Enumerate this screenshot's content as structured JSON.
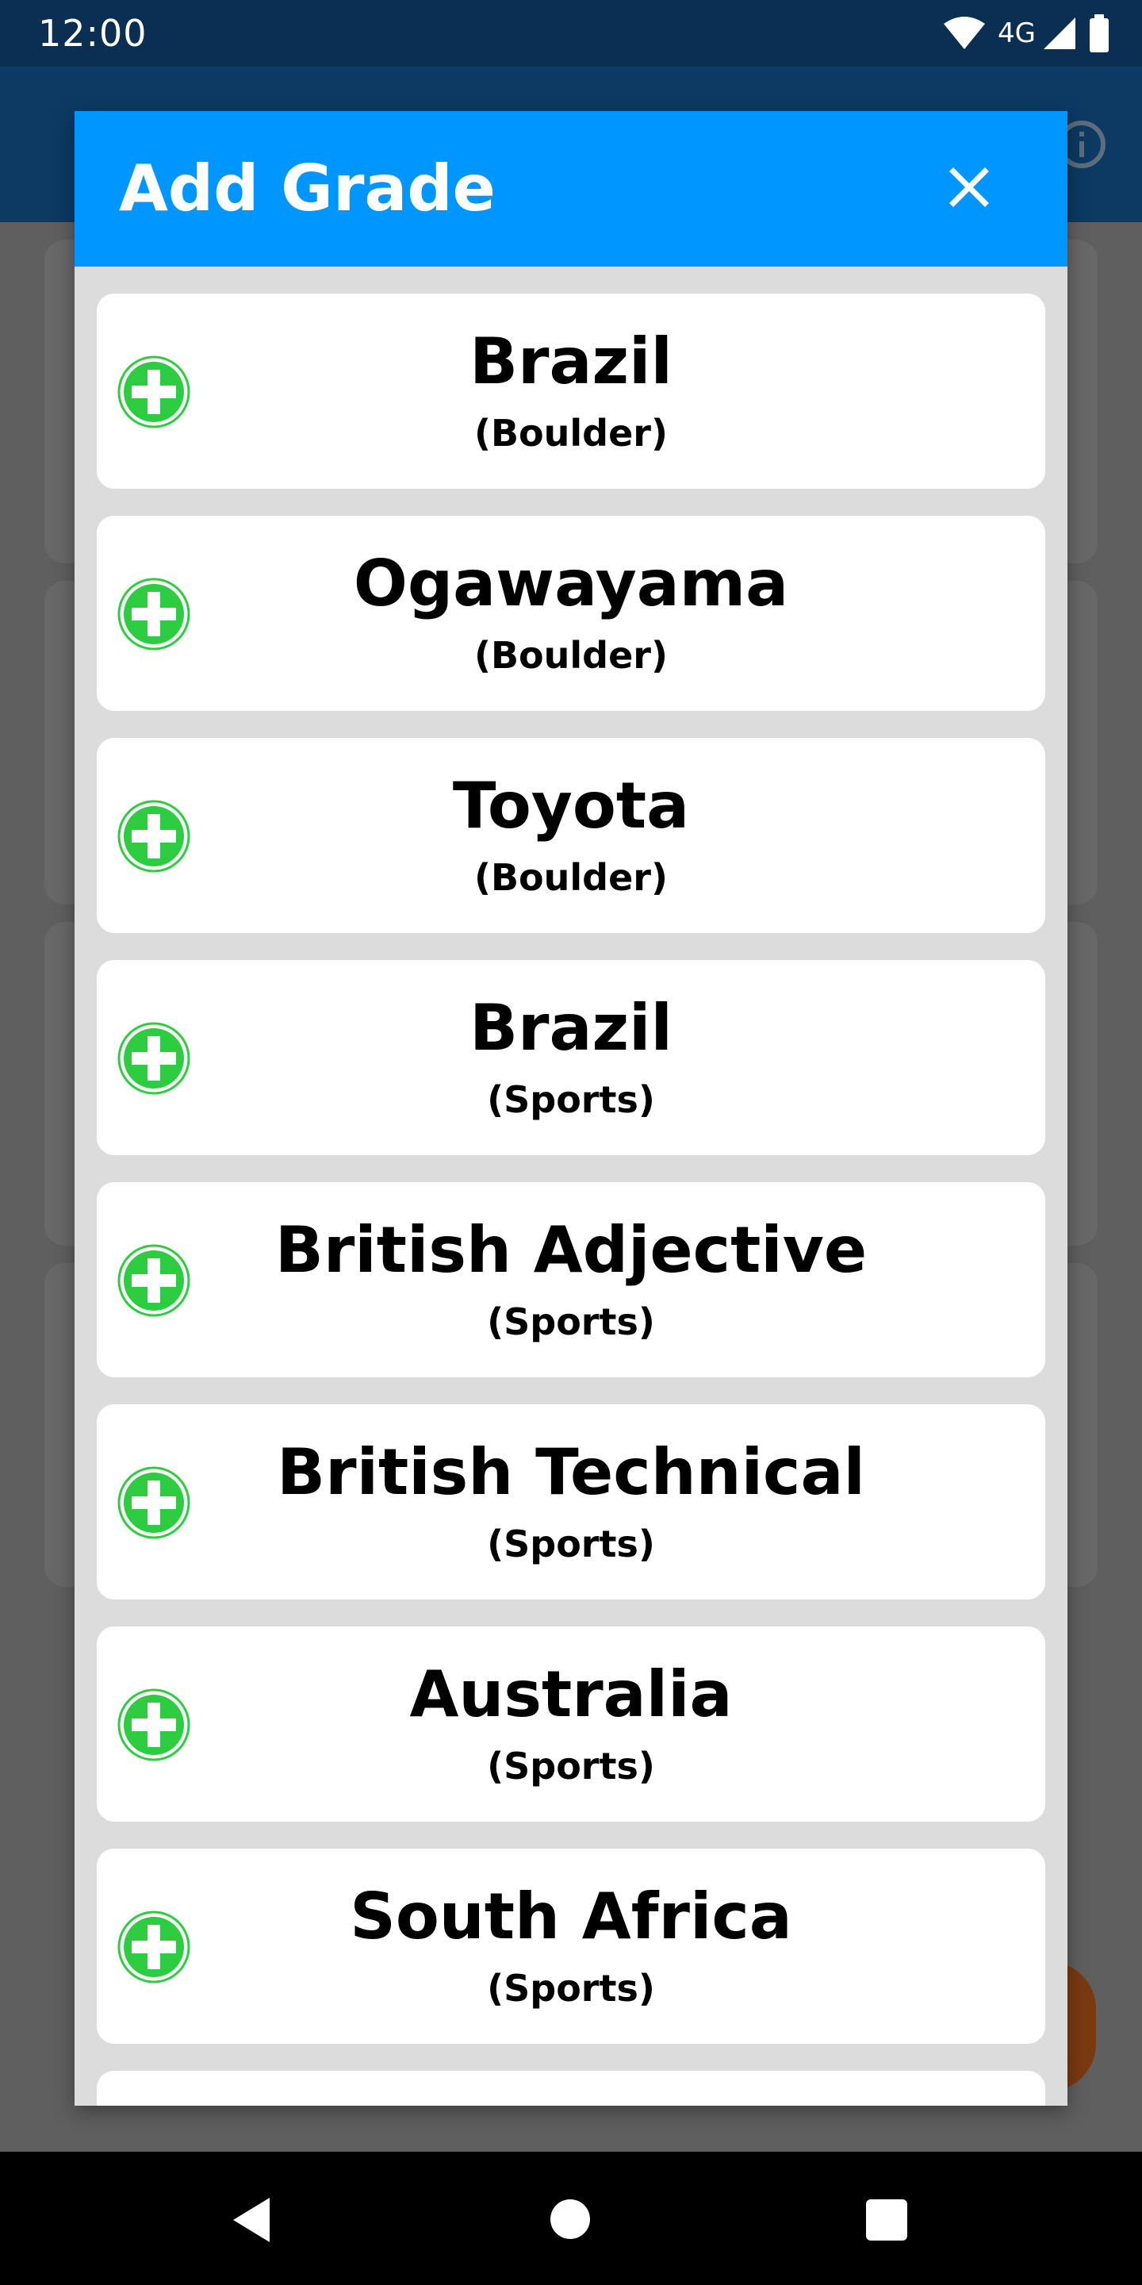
{
  "status_bar": {
    "time": "12:00",
    "network": "4G"
  },
  "dialog": {
    "title": "Add Grade",
    "close_icon": "close-icon",
    "accent_color": "#0096ff",
    "add_icon_color": "#2ecc40",
    "items": [
      {
        "name": "Brazil",
        "type": "(Boulder)"
      },
      {
        "name": "Ogawayama",
        "type": "(Boulder)"
      },
      {
        "name": "Toyota",
        "type": "(Boulder)"
      },
      {
        "name": "Brazil",
        "type": "(Sports)"
      },
      {
        "name": "British Adjective",
        "type": "(Sports)"
      },
      {
        "name": "British Technical",
        "type": "(Sports)"
      },
      {
        "name": "Australia",
        "type": "(Sports)"
      },
      {
        "name": "South Africa",
        "type": "(Sports)"
      },
      {
        "name": "",
        "type": ""
      }
    ]
  },
  "nav_bar": {
    "back": "back-icon",
    "home": "home-icon",
    "recents": "recents-icon"
  }
}
